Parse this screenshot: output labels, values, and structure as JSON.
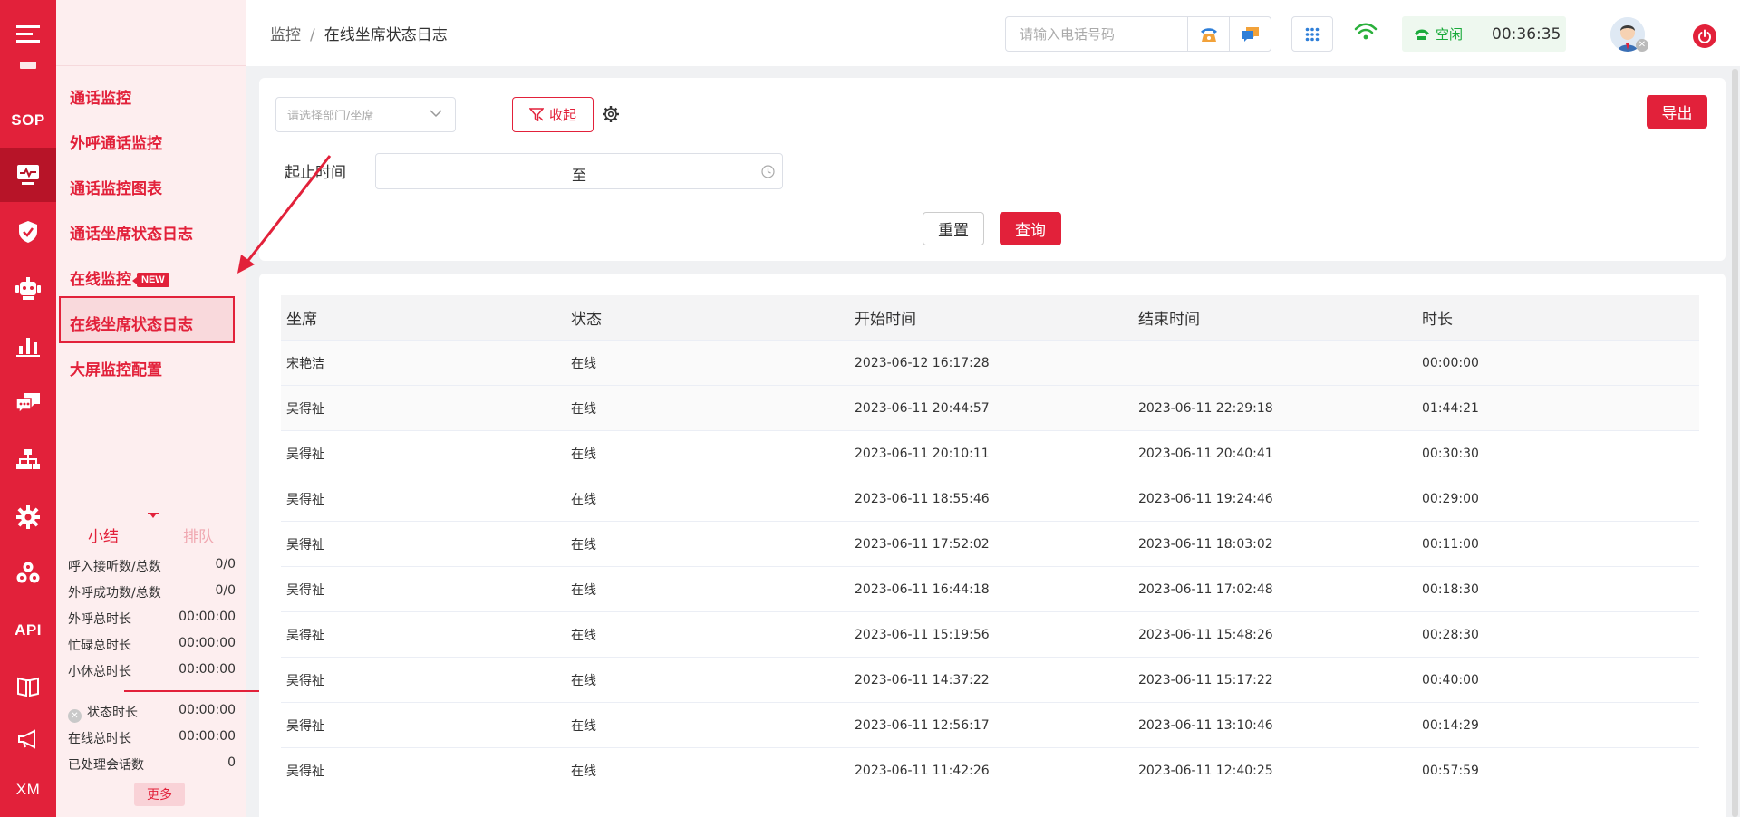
{
  "rail": {
    "items": [
      {
        "name": "menu-toggle-icon",
        "text": ""
      },
      {
        "name": "sop-icon",
        "text": "SOP"
      },
      {
        "name": "monitor-icon",
        "text": ""
      },
      {
        "name": "shield-icon",
        "text": ""
      },
      {
        "name": "robot-icon",
        "text": ""
      },
      {
        "name": "bar-chart-icon",
        "text": ""
      },
      {
        "name": "chat-icon",
        "text": ""
      },
      {
        "name": "org-chart-icon",
        "text": ""
      },
      {
        "name": "gear-icon",
        "text": ""
      },
      {
        "name": "cubes-icon",
        "text": ""
      },
      {
        "name": "api-icon",
        "text": "API"
      },
      {
        "name": "book-icon",
        "text": ""
      },
      {
        "name": "megaphone-icon",
        "text": ""
      },
      {
        "name": "xm-icon",
        "text": "XM"
      }
    ]
  },
  "submenu": {
    "items": [
      {
        "label": "通话监控"
      },
      {
        "label": "外呼通话监控"
      },
      {
        "label": "通话监控图表"
      },
      {
        "label": "通话坐席状态日志"
      },
      {
        "label": "在线监控",
        "badge": "NEW"
      },
      {
        "label": "在线坐席状态日志"
      },
      {
        "label": "大屏监控配置"
      }
    ]
  },
  "stats": {
    "tab_active": "小结",
    "tab_inactive": "排队",
    "rows": [
      {
        "label": "呼入接听数/总数",
        "value": "0/0"
      },
      {
        "label": "外呼成功数/总数",
        "value": "0/0"
      },
      {
        "label": "外呼总时长",
        "value": "00:00:00"
      },
      {
        "label": "忙碌总时长",
        "value": "00:00:00"
      },
      {
        "label": "小休总时长",
        "value": "00:00:00"
      },
      {
        "label": "状态时长",
        "value": "00:00:00"
      },
      {
        "label": "在线总时长",
        "value": "00:00:00"
      },
      {
        "label": "已处理会话数",
        "value": "0"
      }
    ],
    "more_label": "更多"
  },
  "header": {
    "breadcrumb_root": "监控",
    "breadcrumb_sep": "/",
    "breadcrumb_current": "在线坐席状态日志",
    "phone_placeholder": "请输入电话号码",
    "status_label": "空闲",
    "status_time": "00:36:35"
  },
  "filter": {
    "dept_placeholder": "请选择部门/坐席",
    "collapse_label": "收起",
    "export_label": "导出",
    "time_label": "起止时间",
    "time_sep": "至",
    "reset_label": "重置",
    "query_label": "查询"
  },
  "table": {
    "columns": [
      "坐席",
      "状态",
      "开始时间",
      "结束时间",
      "时长"
    ],
    "rows": [
      [
        "宋艳洁",
        "在线",
        "2023-06-12 16:17:28",
        "",
        "00:00:00"
      ],
      [
        "吴得祉",
        "在线",
        "2023-06-11 20:44:57",
        "2023-06-11 22:29:18",
        "01:44:21"
      ],
      [
        "吴得祉",
        "在线",
        "2023-06-11 20:10:11",
        "2023-06-11 20:40:41",
        "00:30:30"
      ],
      [
        "吴得祉",
        "在线",
        "2023-06-11 18:55:46",
        "2023-06-11 19:24:46",
        "00:29:00"
      ],
      [
        "吴得祉",
        "在线",
        "2023-06-11 17:52:02",
        "2023-06-11 18:03:02",
        "00:11:00"
      ],
      [
        "吴得祉",
        "在线",
        "2023-06-11 16:44:18",
        "2023-06-11 17:02:48",
        "00:18:30"
      ],
      [
        "吴得祉",
        "在线",
        "2023-06-11 15:19:56",
        "2023-06-11 15:48:26",
        "00:28:30"
      ],
      [
        "吴得祉",
        "在线",
        "2023-06-11 14:37:22",
        "2023-06-11 15:17:22",
        "00:40:00"
      ],
      [
        "吴得祉",
        "在线",
        "2023-06-11 12:56:17",
        "2023-06-11 13:10:46",
        "00:14:29"
      ],
      [
        "吴得祉",
        "在线",
        "2023-06-11 11:42:26",
        "2023-06-11 12:40:25",
        "00:57:59"
      ]
    ]
  },
  "colors": {
    "brand": "#e2213a",
    "brand_dark": "#b71428",
    "idle_green": "#1aaa3b"
  }
}
